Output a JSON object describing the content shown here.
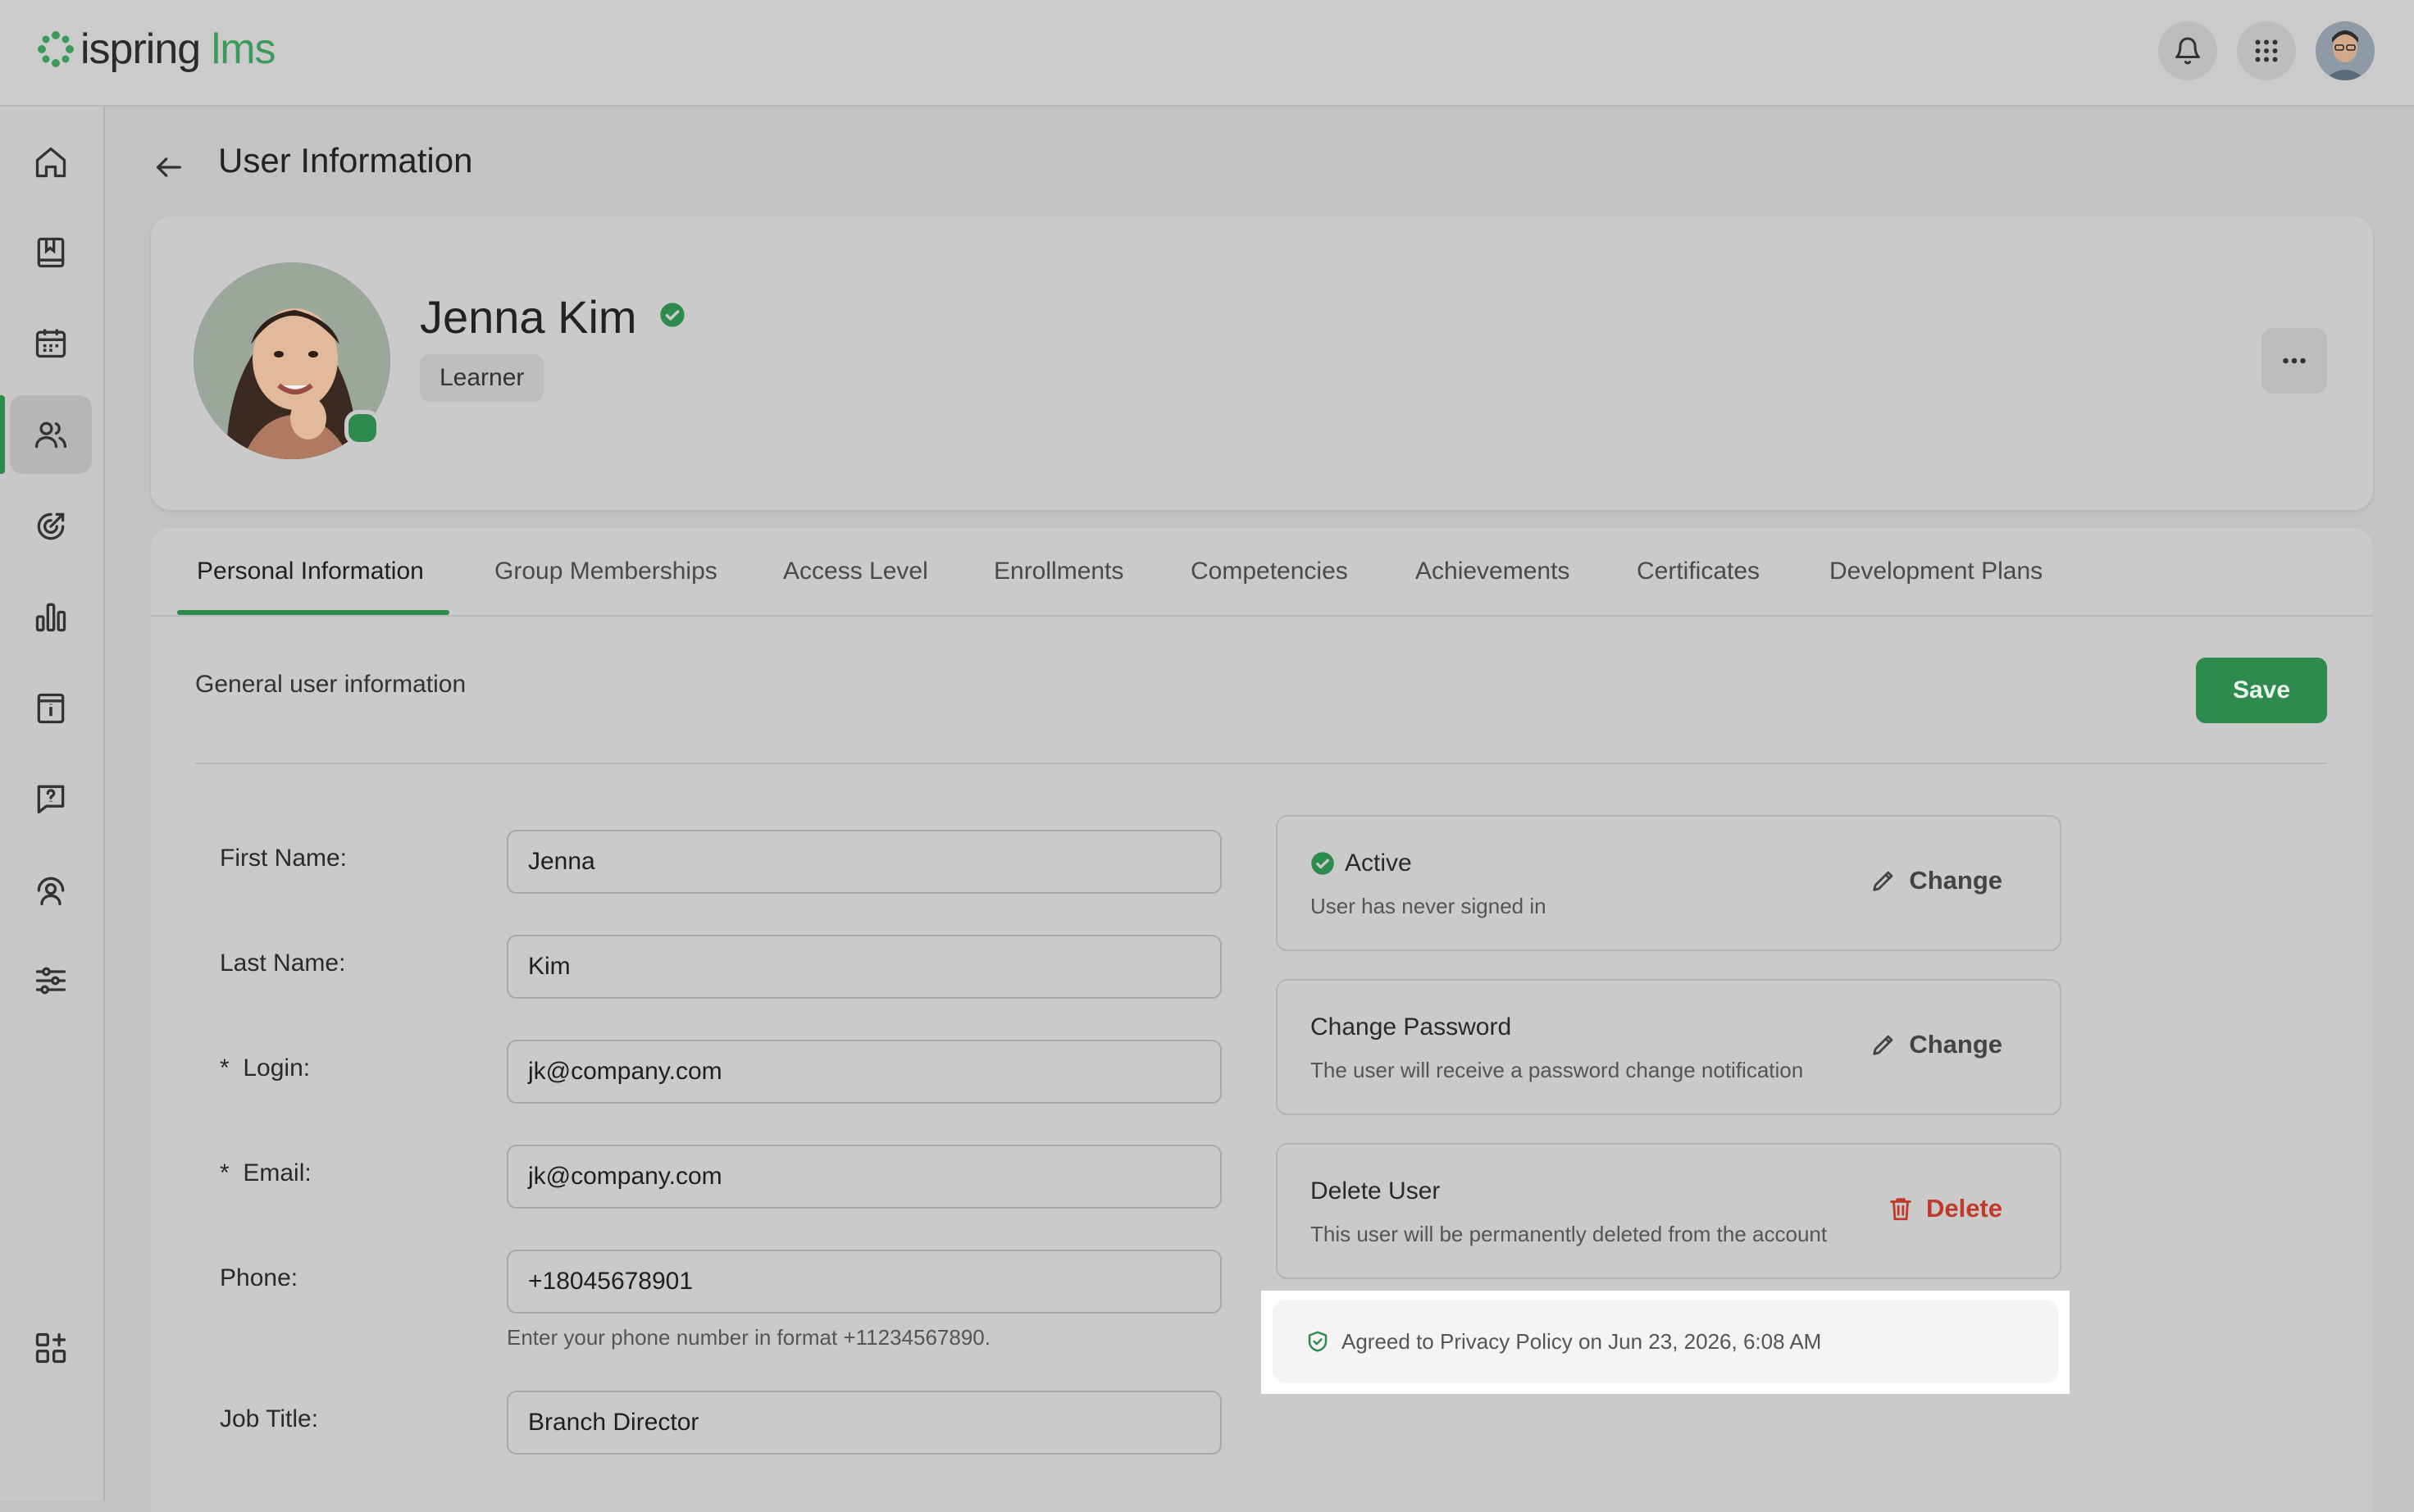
{
  "app": {
    "logo_main": "ispring",
    "logo_accent": "lms"
  },
  "header": {
    "icons": [
      "bell-icon",
      "apps-grid-icon",
      "user-avatar"
    ]
  },
  "sidebar": {
    "items": [
      {
        "icon": "home-icon"
      },
      {
        "icon": "book-icon"
      },
      {
        "icon": "calendar-icon"
      },
      {
        "icon": "users-icon",
        "active": true
      },
      {
        "icon": "target-icon"
      },
      {
        "icon": "reports-chart-icon"
      },
      {
        "icon": "info-catalog-icon"
      },
      {
        "icon": "help-chat-icon"
      },
      {
        "icon": "support-user-icon"
      },
      {
        "icon": "settings-sliders-icon"
      },
      {
        "icon": "add-widget-icon"
      }
    ]
  },
  "page": {
    "title": "User Information"
  },
  "profile": {
    "name": "Jenna Kim",
    "role": "Learner",
    "status_color": "#2e8b4e"
  },
  "tabs": [
    {
      "label": "Personal Information",
      "active": true
    },
    {
      "label": "Group Memberships"
    },
    {
      "label": "Access Level"
    },
    {
      "label": "Enrollments"
    },
    {
      "label": "Competencies"
    },
    {
      "label": "Achievements"
    },
    {
      "label": "Certificates"
    },
    {
      "label": "Development Plans"
    }
  ],
  "form": {
    "section_title": "General user information",
    "save_label": "Save",
    "fields": {
      "first_name": {
        "label": "First Name:",
        "value": "Jenna"
      },
      "last_name": {
        "label": "Last Name:",
        "value": "Kim"
      },
      "login": {
        "label": "Login:",
        "value": "jk@company.com",
        "required": "*"
      },
      "email": {
        "label": "Email:",
        "value": "jk@company.com",
        "required": "*"
      },
      "phone": {
        "label": "Phone:",
        "value": "+18045678901",
        "hint": "Enter your phone number in format +11234567890."
      },
      "job_title": {
        "label": "Job Title:",
        "value": "Branch Director"
      }
    }
  },
  "panels": {
    "status": {
      "title": "Active",
      "subtitle": "User has never signed in",
      "action": "Change"
    },
    "password": {
      "title": "Change Password",
      "subtitle": "The user will receive a password change notification",
      "action": "Change"
    },
    "delete": {
      "title": "Delete User",
      "subtitle": "This user will be permanently deleted from the account",
      "action": "Delete"
    }
  },
  "privacy": {
    "text": "Agreed to Privacy Policy on Jun 23, 2026, 6:08 AM"
  },
  "colors": {
    "accent": "#2e8b4e",
    "danger": "#c0392b"
  }
}
